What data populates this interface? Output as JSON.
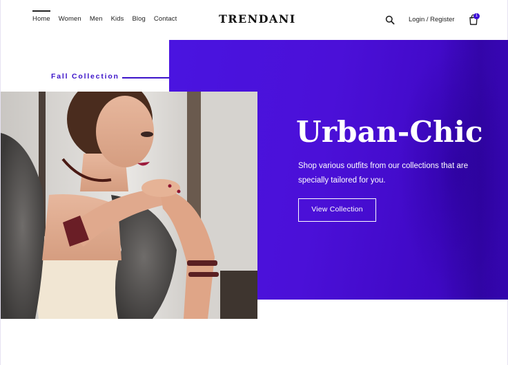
{
  "header": {
    "nav": [
      {
        "label": "Home",
        "active": true
      },
      {
        "label": "Women"
      },
      {
        "label": "Men"
      },
      {
        "label": "Kids"
      },
      {
        "label": "Blog"
      },
      {
        "label": "Contact"
      }
    ],
    "brand": "TRENDANI",
    "login_label": "Login / Register",
    "search_icon": "search-icon",
    "cart_icon": "shopping-bag-icon",
    "cart_count": "1"
  },
  "hero": {
    "tagline": "Fall Collection",
    "title": "Urban-Chic",
    "subtitle": "Shop various outfits from our collections that are specially tailored for you.",
    "button_label": "View Collection",
    "accent_color": "#4a14e0"
  }
}
